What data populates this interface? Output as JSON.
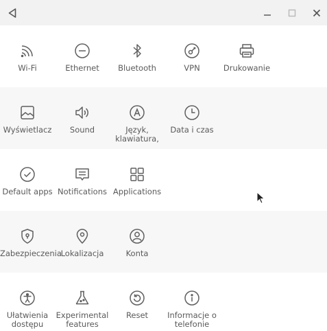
{
  "window": {
    "controls": [
      "back-icon",
      "minimize-icon",
      "maximize-icon",
      "close-icon"
    ]
  },
  "sections": [
    {
      "items": [
        {
          "label": "Wi-Fi",
          "icon": "wifi-icon"
        },
        {
          "label": "Ethernet",
          "icon": "ethernet-icon"
        },
        {
          "label": "Bluetooth",
          "icon": "bluetooth-icon"
        },
        {
          "label": "VPN",
          "icon": "vpn-icon"
        },
        {
          "label": "Drukowanie",
          "icon": "printer-icon"
        }
      ]
    },
    {
      "items": [
        {
          "label": "Wyświetlacz",
          "icon": "display-icon"
        },
        {
          "label": "Sound",
          "icon": "speaker-icon"
        },
        {
          "label": "Język, klawiatura,",
          "icon": "language-icon"
        },
        {
          "label": "Data i czas",
          "icon": "clock-icon"
        }
      ]
    },
    {
      "items": [
        {
          "label": "Default apps",
          "icon": "check-circle-icon"
        },
        {
          "label": "Notifications",
          "icon": "notifications-icon"
        },
        {
          "label": "Applications",
          "icon": "apps-grid-icon"
        }
      ]
    },
    {
      "items": [
        {
          "label": "Zabezpieczenia",
          "icon": "shield-lock-icon"
        },
        {
          "label": "Lokalizacja",
          "icon": "location-pin-icon"
        },
        {
          "label": "Konta",
          "icon": "account-icon"
        }
      ]
    },
    {
      "items": [
        {
          "label": "Ułatwienia dostępu",
          "icon": "accessibility-icon"
        },
        {
          "label": "Experimental features",
          "icon": "flask-icon"
        },
        {
          "label": "Reset",
          "icon": "reset-icon"
        },
        {
          "label": "Informacje o telefonie",
          "icon": "info-icon"
        }
      ]
    }
  ]
}
